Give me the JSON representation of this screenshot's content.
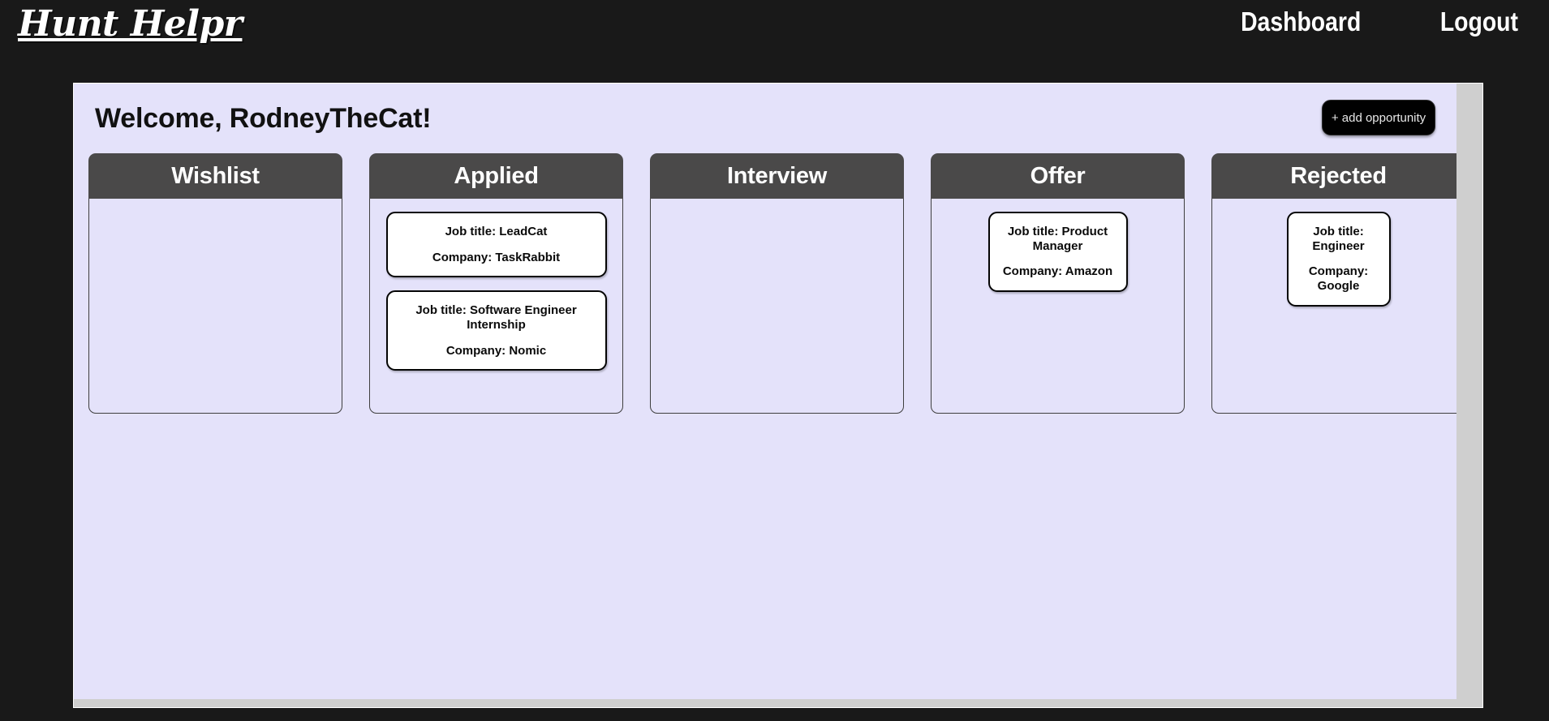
{
  "navbar": {
    "brand": "Hunt Helpr",
    "links": [
      {
        "label": "Dashboard",
        "name": "dashboard"
      },
      {
        "label": "Logout",
        "name": "logout"
      }
    ]
  },
  "page": {
    "welcome": "Welcome, RodneyTheCat!",
    "add_button": "+ add opportunity"
  },
  "board": {
    "columns": [
      {
        "key": "wishlist",
        "title": "Wishlist",
        "cards": []
      },
      {
        "key": "applied",
        "title": "Applied",
        "cards": [
          {
            "title": "Job title: LeadCat",
            "company": "Company: TaskRabbit"
          },
          {
            "title": "Job title: Software Engineer Internship",
            "company": "Company: Nomic"
          }
        ]
      },
      {
        "key": "interview",
        "title": "Interview",
        "cards": []
      },
      {
        "key": "offer",
        "title": "Offer",
        "cards": [
          {
            "title": "Job title: Product Manager",
            "company": "Company: Amazon"
          }
        ]
      },
      {
        "key": "rejected",
        "title": "Rejected",
        "cards": [
          {
            "title": "Job title: Engineer",
            "company": "Company: Google"
          }
        ]
      }
    ]
  },
  "colors": {
    "page_background": "#191919",
    "panel_background": "#e4e2fa",
    "column_header": "#4a4949",
    "card_background": "#ffffff",
    "accent_button": "#010101",
    "scrollbar": "#cfcfcf"
  }
}
